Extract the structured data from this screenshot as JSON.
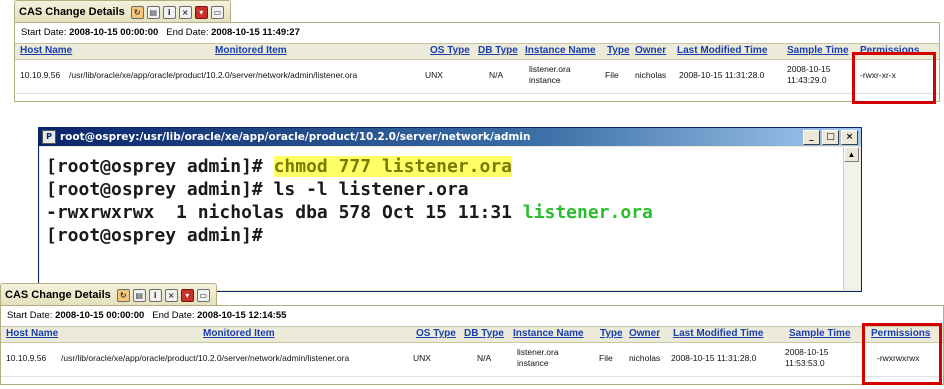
{
  "colors": {
    "link": "#1a3eaf",
    "highlight": "#d40000",
    "terminal_green": "#2bbd2b",
    "terminal_highlight": "#ffff66"
  },
  "top_panel": {
    "tab_title": "CAS Change Details",
    "toolbar_icons": [
      "refresh-icon",
      "print-icon",
      "info-icon",
      "close-icon",
      "dropdown-icon",
      "window-icon"
    ],
    "start_label": "Start Date:",
    "start_value": "2008-10-15 00:00:00",
    "end_label": "End Date:",
    "end_value": "2008-10-15 11:49:27",
    "columns": [
      "Host Name",
      "Monitored Item",
      "OS Type",
      "DB Type",
      "Instance Name",
      "Type",
      "Owner",
      "Last Modified Time",
      "Sample Time",
      "Permissions"
    ],
    "row": {
      "host": "10.10.9.56",
      "item": "/usr/lib/oracle/xe/app/oracle/product/10.2.0/server/network/admin/listener.ora",
      "os": "UNX",
      "db": "N/A",
      "instance_1": "listener.ora",
      "instance_2": "instance",
      "type": "File",
      "owner": "nicholas",
      "modified": "2008-10-15 11:31:28.0",
      "sample_1": "2008-10-15",
      "sample_2": "11:43:29.0",
      "permissions": "-rwxr-xr-x"
    }
  },
  "terminal": {
    "title": "root@osprey:/usr/lib/oracle/xe/app/oracle/product/10.2.0/server/network/admin",
    "minimize": "_",
    "maximize": "□",
    "close": "×",
    "line1_prompt": "[root@osprey admin]# ",
    "line1_cmd": "chmod 777 listener.ora",
    "line2": "[root@osprey admin]# ls -l listener.ora",
    "line3_prefix": "-rwxrwxrwx  1 nicholas dba 578 Oct 15 11:31 ",
    "line3_file": "listener.ora",
    "line4": "[root@osprey admin]#"
  },
  "bottom_panel": {
    "tab_title": "CAS Change Details",
    "toolbar_icons": [
      "refresh-icon",
      "print-icon",
      "info-icon",
      "close-icon",
      "dropdown-icon",
      "window-icon"
    ],
    "start_label": "Start Date:",
    "start_value": "2008-10-15 00:00:00",
    "end_label": "End Date:",
    "end_value": "2008-10-15 12:14:55",
    "columns": [
      "Host Name",
      "Monitored Item",
      "OS Type",
      "DB Type",
      "Instance Name",
      "Type",
      "Owner",
      "Last Modified Time",
      "Sample Time",
      "Permissions"
    ],
    "row": {
      "host": "10.10.9.56",
      "item": "/usr/lib/oracle/xe/app/oracle/product/10.2.0/server/network/admin/listener.ora",
      "os": "UNX",
      "db": "N/A",
      "instance_1": "listener.ora",
      "instance_2": "instance",
      "type": "File",
      "owner": "nicholas",
      "modified": "2008-10-15 11:31:28.0",
      "sample_1": "2008-10-15",
      "sample_2": "11:53:53.0",
      "permissions": "-rwxrwxrwx"
    }
  }
}
